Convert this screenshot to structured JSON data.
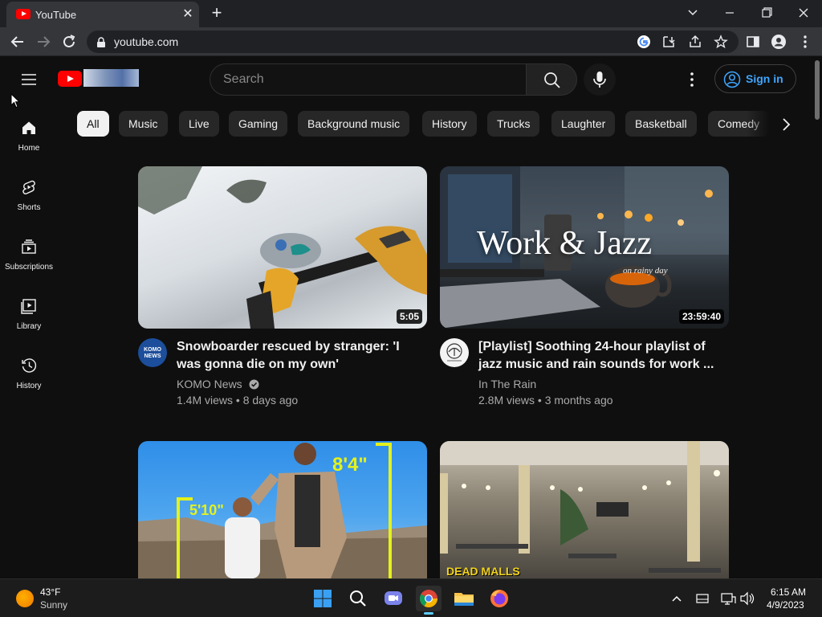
{
  "browser": {
    "tab_title": "YouTube",
    "close_tab": "✕",
    "new_tab": "+",
    "url": "youtube.com"
  },
  "header": {
    "search_placeholder": "Search",
    "signin_label": "Sign in"
  },
  "guide": [
    {
      "label": "Home",
      "icon": "home-icon"
    },
    {
      "label": "Shorts",
      "icon": "shorts-icon"
    },
    {
      "label": "Subscriptions",
      "icon": "subscriptions-icon"
    },
    {
      "label": "Library",
      "icon": "library-icon"
    },
    {
      "label": "History",
      "icon": "history-icon"
    }
  ],
  "chips": [
    "All",
    "Music",
    "Live",
    "Gaming",
    "Background music",
    "History",
    "Trucks",
    "Laughter",
    "Basketball",
    "Comedy"
  ],
  "videos": [
    {
      "title": "Snowboarder rescued by stranger: 'I was gonna die on my own'",
      "channel": "KOMO News",
      "verified": true,
      "meta": "1.4M views • 8 days ago",
      "duration": "5:05",
      "avatar_text": "KOMO NEWS"
    },
    {
      "title": "[Playlist] Soothing 24-hour playlist of jazz music and rain sounds for work ...",
      "channel": "In The Rain",
      "verified": false,
      "meta": "2.8M views • 3 months ago",
      "duration": "23:59:40",
      "thumb_text": "Work & Jazz",
      "thumb_subtext": "on rainy day"
    },
    {
      "thumb_text_1": "8'4\"",
      "thumb_text_2": "5'10\""
    },
    {
      "thumb_text": "DEAD MALLS"
    }
  ],
  "taskbar": {
    "weather_temp": "43°F",
    "weather_cond": "Sunny",
    "time": "6:15 AM",
    "date": "4/9/2023"
  },
  "colors": {
    "background": "#0f0f0f",
    "chip": "#272727",
    "chip_active": "#f1f1f1",
    "link_blue": "#3ea6ff",
    "brand_red": "#ff0000"
  }
}
